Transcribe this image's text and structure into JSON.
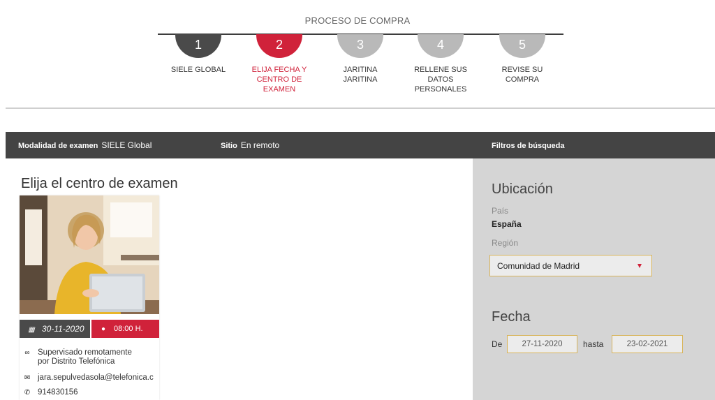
{
  "steps": {
    "title": "PROCESO DE COMPRA",
    "items": [
      {
        "number": "1",
        "label_line1": "SIELE GLOBAL",
        "label_line2": "",
        "state": "done"
      },
      {
        "number": "2",
        "label_line1": "ELIJA FECHA Y",
        "label_line2": "CENTRO DE EXAMEN",
        "state": "active"
      },
      {
        "number": "3",
        "label_line1": "JARITINA JARITINA",
        "label_line2": "",
        "state": "next"
      },
      {
        "number": "4",
        "label_line1": "RELLENE SUS DATOS",
        "label_line2": "PERSONALES",
        "state": "next"
      },
      {
        "number": "5",
        "label_line1": "REVISE SU COMPRA",
        "label_line2": "",
        "state": "next"
      }
    ]
  },
  "topbar": {
    "modalidad_label": "Modalidad de examen",
    "modalidad_value": "SIELE Global",
    "sitio_label": "Sitio",
    "sitio_value": "En remoto",
    "filtros_label": "Filtros de búsqueda"
  },
  "center": {
    "title": "Elija el centro de examen",
    "card": {
      "date": "30-11-2020",
      "time": "08:00 H.",
      "supervision_line1": "Supervisado remotamente",
      "supervision_line2": "por Distrito Telefónica",
      "email": "jara.sepulvedasola@telefonica.c",
      "phone": "914830156"
    }
  },
  "filters": {
    "ubicacion_heading": "Ubicación",
    "pais_label": "País",
    "pais_value": "España",
    "region_label": "Región",
    "region_selected": "Comunidad de Madrid",
    "fecha_heading": "Fecha",
    "de_label": "De",
    "de_value": "27-11-2020",
    "hasta_label": "hasta",
    "hasta_value": "23-02-2021"
  },
  "colors": {
    "accent": "#d0223a",
    "dark": "#444444",
    "step_inactive": "#b9b9b9",
    "panel_bg": "#d5d5d5",
    "input_border": "#d8b45a"
  },
  "icons": {
    "calendar": "calendar-icon",
    "clock": "clock-icon",
    "supervision": "link-icon",
    "email": "envelope-icon",
    "phone": "phone-icon",
    "dropdown": "chevron-down-icon"
  }
}
